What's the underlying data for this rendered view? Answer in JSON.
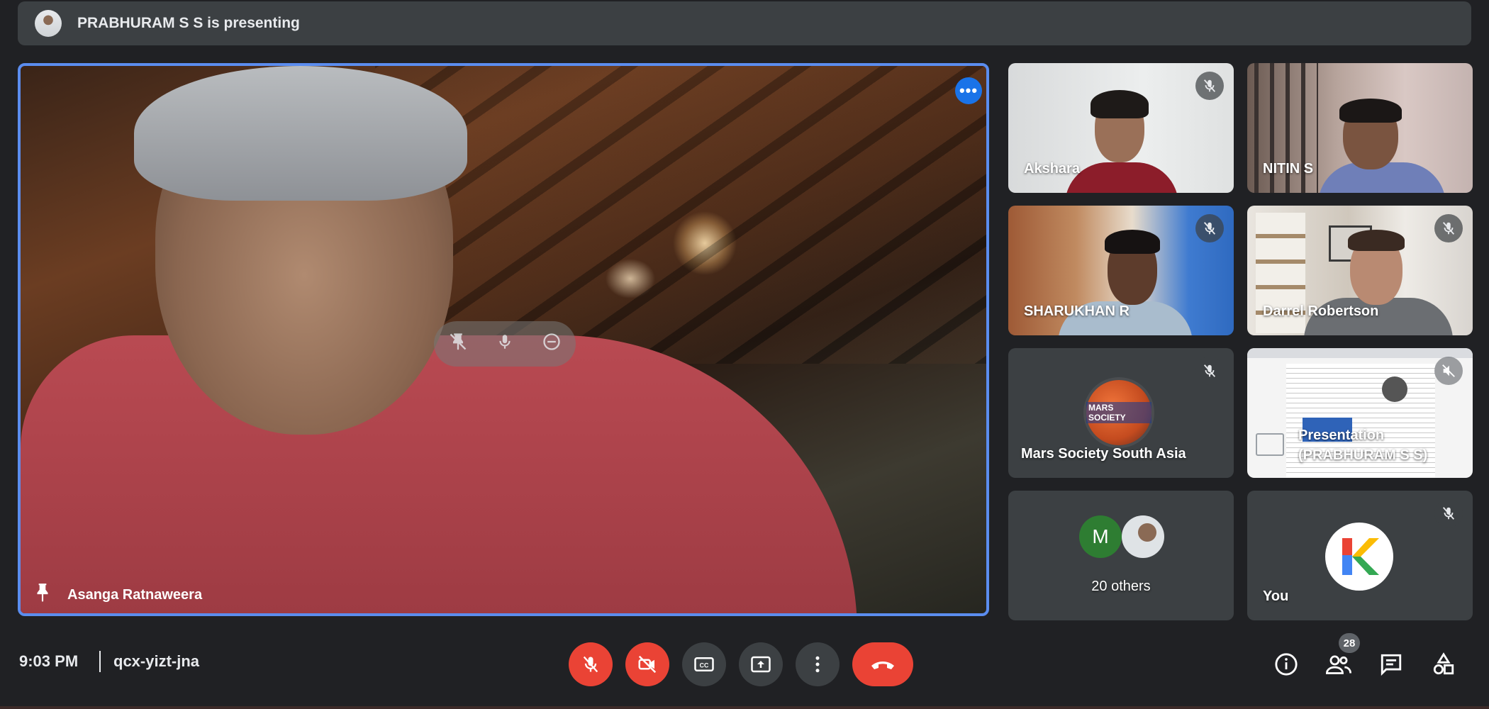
{
  "banner": {
    "presenter_text": "PRABHURAM S S is presenting"
  },
  "main_tile": {
    "name": "Asanga Ratnaweera"
  },
  "tiles": [
    {
      "name": "Akshara"
    },
    {
      "name": "NITIN S"
    },
    {
      "name": "SHARUKHAN R"
    },
    {
      "name": "Darrel Robertson"
    },
    {
      "name": "Mars Society South Asia",
      "logo_text": "MARS SOCIETY"
    },
    {
      "name": "Presentation (PRABHURAM S S)"
    },
    {
      "name": "20 others",
      "avatar_letter": "M"
    },
    {
      "name": "You",
      "avatar_letter": "K"
    }
  ],
  "bottom_bar": {
    "time": "9:03 PM",
    "meeting_code": "qcx-yizt-jna",
    "participants_count": "28"
  },
  "icons": {
    "mic_off": "mic-off-icon",
    "cam_off": "videocam-off-icon",
    "captions": "closed-captions-icon",
    "present": "present-now-icon",
    "more": "more-vert-icon",
    "end_call": "call-end-icon",
    "info": "info-icon",
    "people": "people-icon",
    "chat": "chat-icon",
    "activities": "activities-icon"
  },
  "colors": {
    "accent": "#1a73e8",
    "danger": "#ea4335",
    "tile": "#3c4043",
    "bg": "#202124",
    "active_border": "#5b8def"
  }
}
